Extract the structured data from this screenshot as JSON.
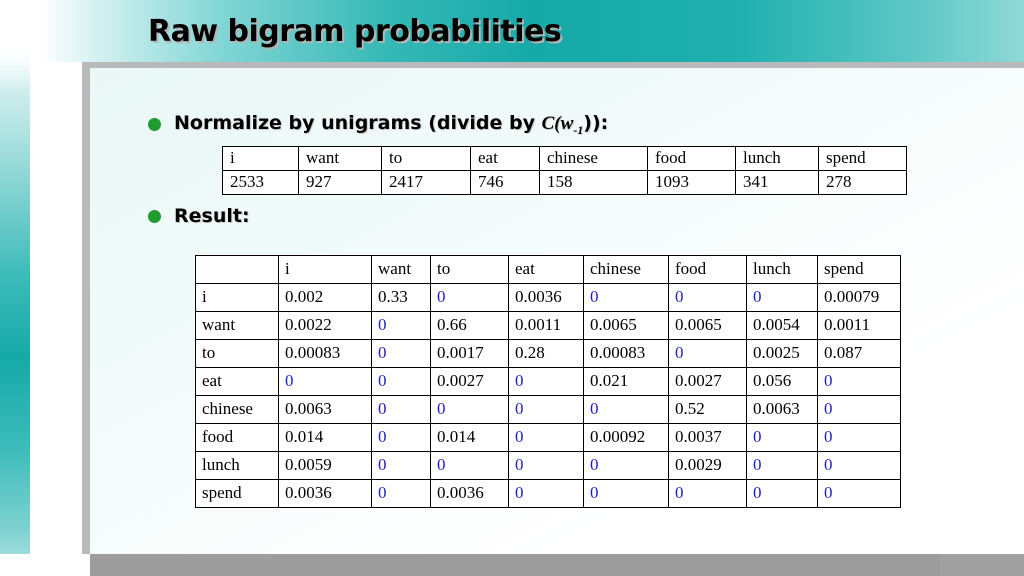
{
  "slide": {
    "title": "Raw bigram probabilities",
    "bullets": [
      {
        "prefix": "Normalize by unigrams (divide by ",
        "italic": "C(w",
        "sub": "-1",
        "suffix": ")):"
      },
      {
        "text": "Result:"
      }
    ]
  },
  "unigram_table": {
    "words": [
      "i",
      "want",
      "to",
      "eat",
      "chinese",
      "food",
      "lunch",
      "spend"
    ],
    "counts": [
      "2533",
      "927",
      "2417",
      "746",
      "158",
      "1093",
      "341",
      "278"
    ]
  },
  "bigram_table": {
    "columns": [
      "",
      "i",
      "want",
      "to",
      "eat",
      "chinese",
      "food",
      "lunch",
      "spend"
    ],
    "rows": [
      {
        "label": "i",
        "values": [
          "0.002",
          "0.33",
          "0",
          "0.0036",
          "0",
          "0",
          "0",
          "0.00079"
        ]
      },
      {
        "label": "want",
        "values": [
          "0.0022",
          "0",
          "0.66",
          "0.0011",
          "0.0065",
          "0.0065",
          "0.0054",
          "0.0011"
        ]
      },
      {
        "label": "to",
        "values": [
          "0.00083",
          "0",
          "0.0017",
          "0.28",
          "0.00083",
          "0",
          "0.0025",
          "0.087"
        ]
      },
      {
        "label": "eat",
        "values": [
          "0",
          "0",
          "0.0027",
          "0",
          "0.021",
          "0.0027",
          "0.056",
          "0"
        ]
      },
      {
        "label": "chinese",
        "values": [
          "0.0063",
          "0",
          "0",
          "0",
          "0",
          "0.52",
          "0.0063",
          "0"
        ]
      },
      {
        "label": "food",
        "values": [
          "0.014",
          "0",
          "0.014",
          "0",
          "0.00092",
          "0.0037",
          "0",
          "0"
        ]
      },
      {
        "label": "lunch",
        "values": [
          "0.0059",
          "0",
          "0",
          "0",
          "0",
          "0.0029",
          "0",
          "0"
        ]
      },
      {
        "label": "spend",
        "values": [
          "0.0036",
          "0",
          "0.0036",
          "0",
          "0",
          "0",
          "0",
          "0"
        ]
      }
    ],
    "zero_color": "#1c1cc8"
  },
  "theme": {
    "accent": "#16a9a8",
    "bullet_color": "#1f9c2f"
  }
}
